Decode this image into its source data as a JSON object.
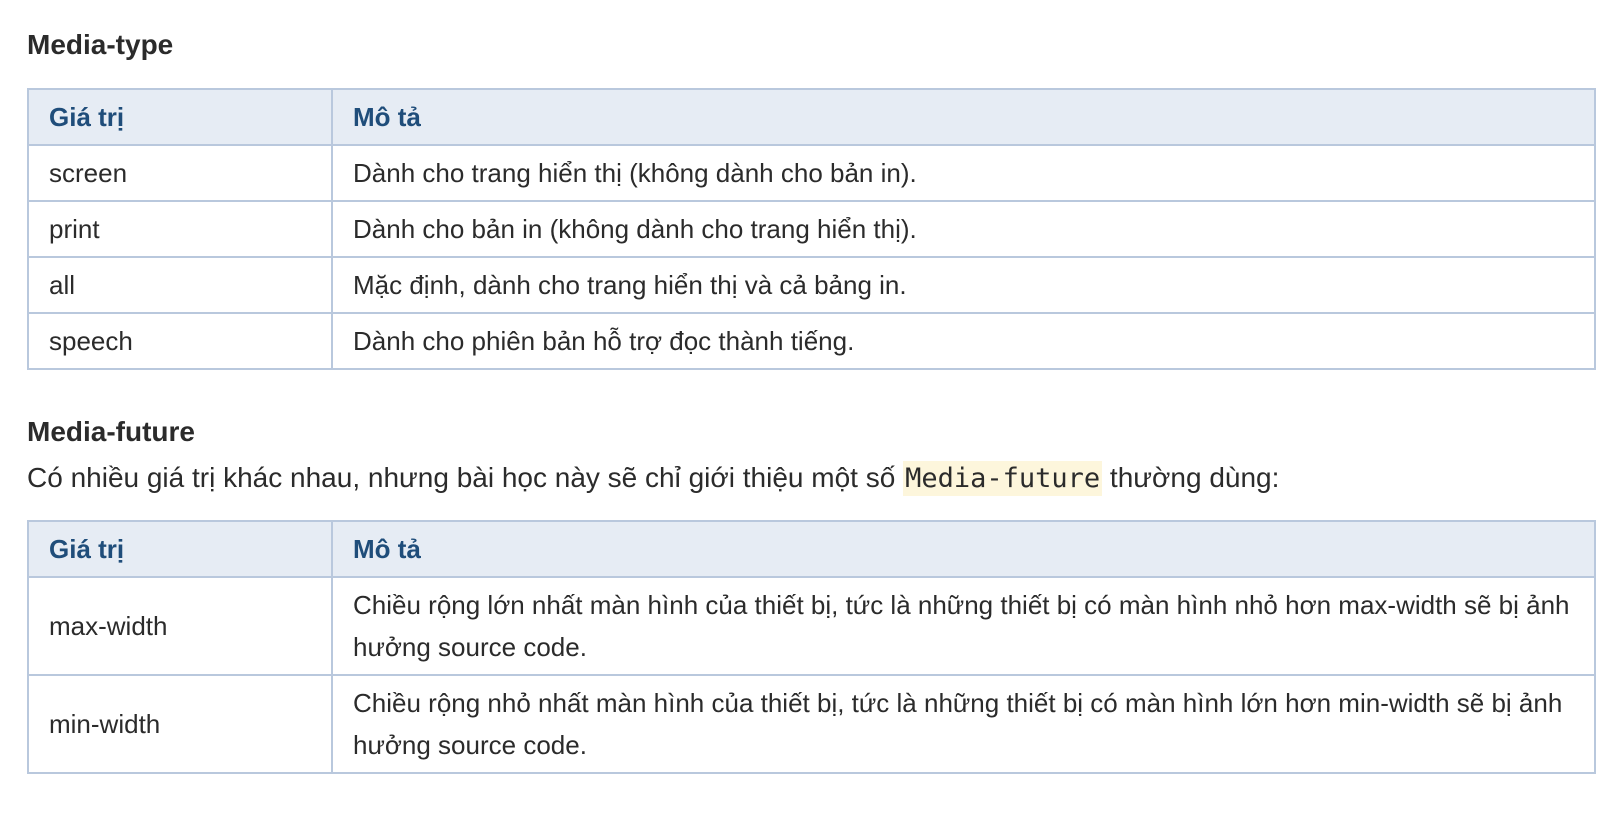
{
  "media_type": {
    "title": "Media-type",
    "table": {
      "headers": [
        "Giá trị",
        "Mô tả"
      ],
      "rows": [
        [
          "screen",
          "Dành cho trang hiển thị (không dành cho bản in)."
        ],
        [
          "print",
          "Dành cho bản in (không dành cho trang hiển thị)."
        ],
        [
          "all",
          "Mặc định, dành cho trang hiển thị và cả bảng in."
        ],
        [
          "speech",
          "Dành cho phiên bản hỗ trợ đọc thành tiếng."
        ]
      ]
    }
  },
  "media_future": {
    "title": "Media-future",
    "intro_before": "Có nhiều giá trị khác nhau, nhưng bài học này sẽ chỉ giới thiệu một số ",
    "intro_code": "Media-future",
    "intro_after": " thường dùng:",
    "table": {
      "headers": [
        "Giá trị",
        "Mô tả"
      ],
      "rows": [
        [
          "max-width",
          "Chiều rộng lớn nhất màn hình của thiết bị, tức là những thiết bị có màn hình nhỏ hơn max-width sẽ bị ảnh hưởng source code."
        ],
        [
          "min-width",
          "Chiều rộng nhỏ nhất màn hình của thiết bị, tức là những thiết bị có màn hình lớn hơn min-width sẽ bị ảnh hưởng source code."
        ]
      ]
    }
  }
}
